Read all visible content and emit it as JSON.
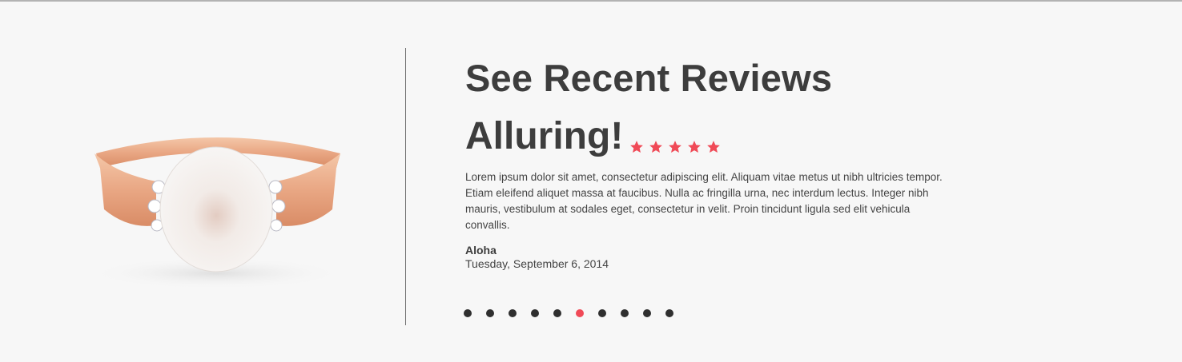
{
  "section": {
    "title": "See Recent Reviews"
  },
  "review": {
    "title": "Alluring!",
    "rating": 5,
    "rating_max": 5,
    "body": "Lorem ipsum dolor sit amet, consectetur adipiscing elit. Aliquam vitae metus ut nibh ultricies tempor. Etiam eleifend aliquet massa at faucibus. Nulla ac fringilla urna, nec interdum lectus. Integer nibh mauris, vestibulum at sodales eget, consectetur in velit. Proin tincidunt ligula sed elit vehicula convallis.",
    "reviewer": "Aloha",
    "date": "Tuesday, September 6, 2014"
  },
  "product": {
    "image_icon": "pearl-ring-image"
  },
  "pager": {
    "count": 10,
    "active_index": 5
  },
  "colors": {
    "accent": "#f04a57",
    "text": "#3d3d3d",
    "background": "#f7f7f7",
    "dot": "#2f2f2f"
  }
}
